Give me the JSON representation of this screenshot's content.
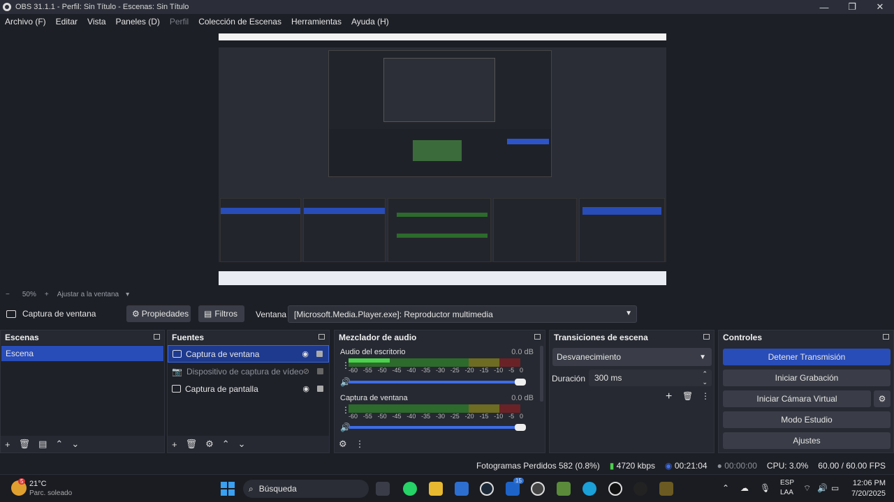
{
  "window": {
    "title": "OBS 31.1.1 - Perfil: Sin Título - Escenas: Sin Título"
  },
  "menu": [
    "Archivo (F)",
    "Editar",
    "Vista",
    "Paneles (D)",
    "Perfil",
    "Colección de Escenas",
    "Herramientas",
    "Ayuda (H)"
  ],
  "zoom": {
    "minus": "−",
    "value": "50%",
    "plus": "+",
    "fit_label": "Ajustar a la ventana"
  },
  "context": {
    "source_name": "Captura de ventana",
    "properties": "Propiedades",
    "filters": "Filtros",
    "window_label": "Ventana",
    "window_value": "[Microsoft.Media.Player.exe]: Reproductor multimedia"
  },
  "scenes": {
    "title": "Escenas",
    "items": [
      "Escena"
    ]
  },
  "sources": {
    "title": "Fuentes",
    "items": [
      "Captura de ventana",
      "Dispositivo de captura de vídeo",
      "Captura de pantalla"
    ]
  },
  "mixer": {
    "title": "Mezclador de audio",
    "channels": [
      {
        "name": "Audio del escritorio",
        "db": "0.0 dB",
        "level": 0.24
      },
      {
        "name": "Captura de ventana",
        "db": "0.0 dB",
        "level": 0
      }
    ],
    "ticks": [
      "-60",
      "-55",
      "-50",
      "-45",
      "-40",
      "-35",
      "-30",
      "-25",
      "-20",
      "-15",
      "-10",
      "-5",
      "0"
    ]
  },
  "transitions": {
    "title": "Transiciones de escena",
    "selected": "Desvanecimiento",
    "duration_label": "Duración",
    "duration_value": "300 ms"
  },
  "controls": {
    "title": "Controles",
    "buttons": [
      "Detener Transmisión",
      "Iniciar Grabación",
      "Iniciar Cámara Virtual",
      "Modo Estudio",
      "Ajustes"
    ]
  },
  "status": {
    "dropped": "Fotogramas Perdidos 582 (0.8%)",
    "bitrate": "4720 kbps",
    "stream_time": "00:21:04",
    "rec_time": "00:00:00",
    "cpu": "CPU: 3.0%",
    "fps": "60.00 / 60.00 FPS"
  },
  "taskbar": {
    "weather_temp": "21°C",
    "weather_desc": "Parc. soleado",
    "weather_badge": "5",
    "search": "Búsqueda",
    "lang1": "ESP",
    "lang2": "LAA",
    "time": "12:06 PM",
    "date": "7/20/2025",
    "store_badge": "15"
  },
  "colors": {
    "accent": "#284cb8",
    "bg": "#1d1f26",
    "dock": "#262932"
  }
}
